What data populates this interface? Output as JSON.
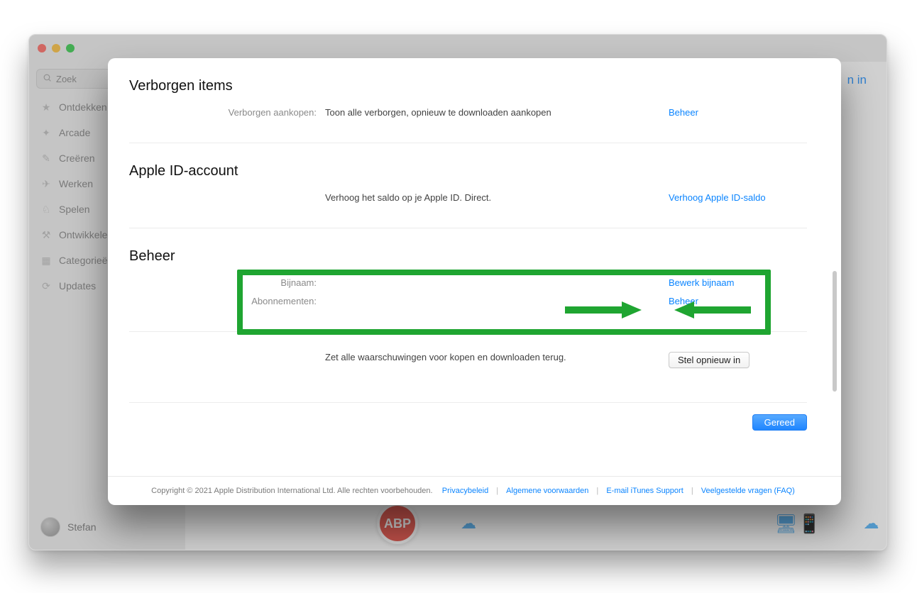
{
  "host": {
    "search_placeholder": "Zoek",
    "sidebar": {
      "items": [
        {
          "icon": "★",
          "label": "Ontdekken"
        },
        {
          "icon": "✦",
          "label": "Arcade"
        },
        {
          "icon": "✎",
          "label": "Creëren"
        },
        {
          "icon": "✈",
          "label": "Werken"
        },
        {
          "icon": "♘",
          "label": "Spelen"
        },
        {
          "icon": "⚒",
          "label": "Ontwikkelen"
        },
        {
          "icon": "▦",
          "label": "Categorieën"
        },
        {
          "icon": "⟳",
          "label": "Updates"
        }
      ]
    },
    "profile_name": "Stefan",
    "login_fragment": "n in"
  },
  "modal": {
    "sections": {
      "hidden": {
        "title": "Verborgen items",
        "label": "Verborgen aankopen:",
        "text": "Toon alle verborgen, opnieuw te downloaden aankopen",
        "action": "Beheer"
      },
      "appleid": {
        "title": "Apple ID-account",
        "text": "Verhoog het saldo op je Apple ID. Direct.",
        "action": "Verhoog Apple ID-saldo"
      },
      "beheer": {
        "title": "Beheer",
        "rows": [
          {
            "label": "Bijnaam:",
            "action": "Bewerk bijnaam"
          },
          {
            "label": "Abonnementen:",
            "action": "Beheer"
          }
        ]
      },
      "reset": {
        "text": "Zet alle waarschuwingen voor kopen en downloaden terug.",
        "button": "Stel opnieuw in"
      }
    },
    "done": "Gereed",
    "footer": {
      "copyright": "Copyright © 2021 Apple Distribution International Ltd. Alle rechten voorbehouden.",
      "links": [
        "Privacybeleid",
        "Algemene voorwaarden",
        "E-mail iTunes Support",
        "Veelgestelde vragen (FAQ)"
      ]
    }
  },
  "annotation": {
    "color": "#1fa531"
  }
}
